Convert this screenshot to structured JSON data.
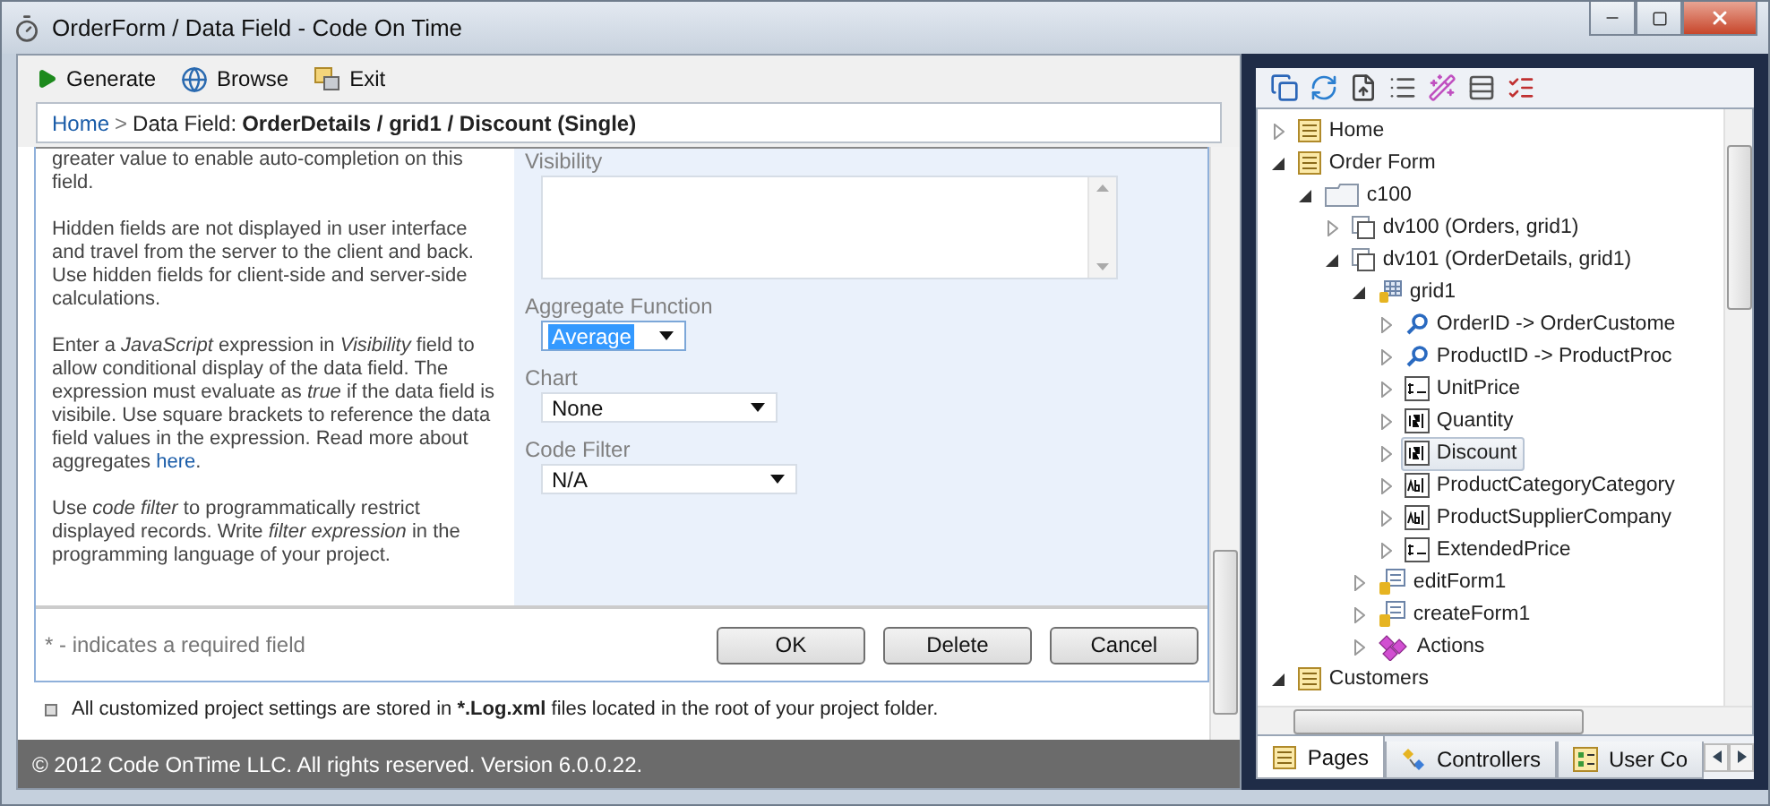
{
  "window": {
    "title": "OrderForm / Data Field - Code On Time"
  },
  "toolbar": [
    {
      "label": "Generate",
      "kind": "play"
    },
    {
      "label": "Browse",
      "kind": "globe"
    },
    {
      "label": "Exit",
      "kind": "exit"
    }
  ],
  "breadcrumb": {
    "link": "Home",
    "separator": ">",
    "prefix": "Data Field:",
    "current": "OrderDetails / grid1 / Discount (Single)"
  },
  "help": [
    {
      "text": "greater value to enable auto-completion on this field."
    },
    {
      "text": "Hidden fields are not displayed in user interface and travel from the server to the client and back. Use hidden fields for client-side and server-side calculations."
    },
    {
      "text": "Enter a *JavaScript* expression in *Visibility* field to allow conditional display of the data field. The expression must evaluate as *true* if the data field is visibile. Use square brackets to reference the data field values in the expression. Read more about aggregates",
      "link": "here",
      "after": "."
    },
    {
      "text": "Use *code filter* to programmatically restrict displayed records. Write *filter expression* in the programming language of your project."
    }
  ],
  "form": [
    {
      "kind": "textarea",
      "label": "Visibility"
    },
    {
      "kind": "select",
      "label": "Aggregate Function",
      "value": "Average",
      "focused": true
    },
    {
      "kind": "select",
      "label": "Chart",
      "value": "None",
      "focused": false
    },
    {
      "kind": "select",
      "label": "Code Filter",
      "value": "N/A",
      "focused": false
    }
  ],
  "required_note": "* - indicates a required field",
  "buttons": [
    "OK",
    "Delete",
    "Cancel"
  ],
  "note": {
    "before": "All customized project settings are stored in",
    "bold": "*.Log.xml",
    "after": "files located in the root of your project folder."
  },
  "status_bar": "© 2012 Code OnTime LLC. All rights reserved. Version 6.0.0.22.",
  "tree": [
    {
      "label": "Home",
      "kind": "page",
      "expanded": false,
      "selected": false
    },
    {
      "label": "Order Form",
      "kind": "page",
      "expanded": true,
      "selected": false,
      "children": [
        {
          "label": "c100",
          "kind": "folder",
          "expanded": true,
          "selected": false,
          "children": [
            {
              "label": "dv100 (Orders, grid1)",
              "kind": "view",
              "expanded": false,
              "selected": false
            },
            {
              "label": "dv101 (OrderDetails, grid1)",
              "kind": "view",
              "expanded": true,
              "selected": false,
              "children": [
                {
                  "label": "grid1",
                  "kind": "grid",
                  "expanded": true,
                  "selected": false,
                  "children": [
                    {
                      "label": "OrderID -> OrderCustome",
                      "kind": "lookup",
                      "expanded": false,
                      "selected": false
                    },
                    {
                      "label": "ProductID -> ProductProc",
                      "kind": "lookup",
                      "expanded": false,
                      "selected": false
                    },
                    {
                      "label": "UnitPrice",
                      "kind": "currency",
                      "expanded": false,
                      "selected": false
                    },
                    {
                      "label": "Quantity",
                      "kind": "number",
                      "expanded": false,
                      "selected": false
                    },
                    {
                      "label": "Discount",
                      "kind": "number",
                      "expanded": false,
                      "selected": true
                    },
                    {
                      "label": "ProductCategoryCategory",
                      "kind": "text",
                      "expanded": false,
                      "selected": false
                    },
                    {
                      "label": "ProductSupplierCompany",
                      "kind": "text",
                      "expanded": false,
                      "selected": false
                    },
                    {
                      "label": "ExtendedPrice",
                      "kind": "currency",
                      "expanded": false,
                      "selected": false
                    }
                  ]
                },
                {
                  "label": "editForm1",
                  "kind": "form",
                  "expanded": false,
                  "selected": false
                },
                {
                  "label": "createForm1",
                  "kind": "form",
                  "expanded": false,
                  "selected": false
                },
                {
                  "label": "Actions",
                  "kind": "actions",
                  "expanded": false,
                  "selected": false
                }
              ]
            }
          ]
        }
      ]
    },
    {
      "label": "Customers",
      "kind": "page",
      "expanded": true,
      "selected": false
    }
  ],
  "tabs": [
    {
      "label": "Pages",
      "kind": "page",
      "selected": true
    },
    {
      "label": "Controllers",
      "kind": "controllers",
      "selected": false
    },
    {
      "label": "User Co",
      "kind": "usercontrols",
      "selected": false
    }
  ]
}
